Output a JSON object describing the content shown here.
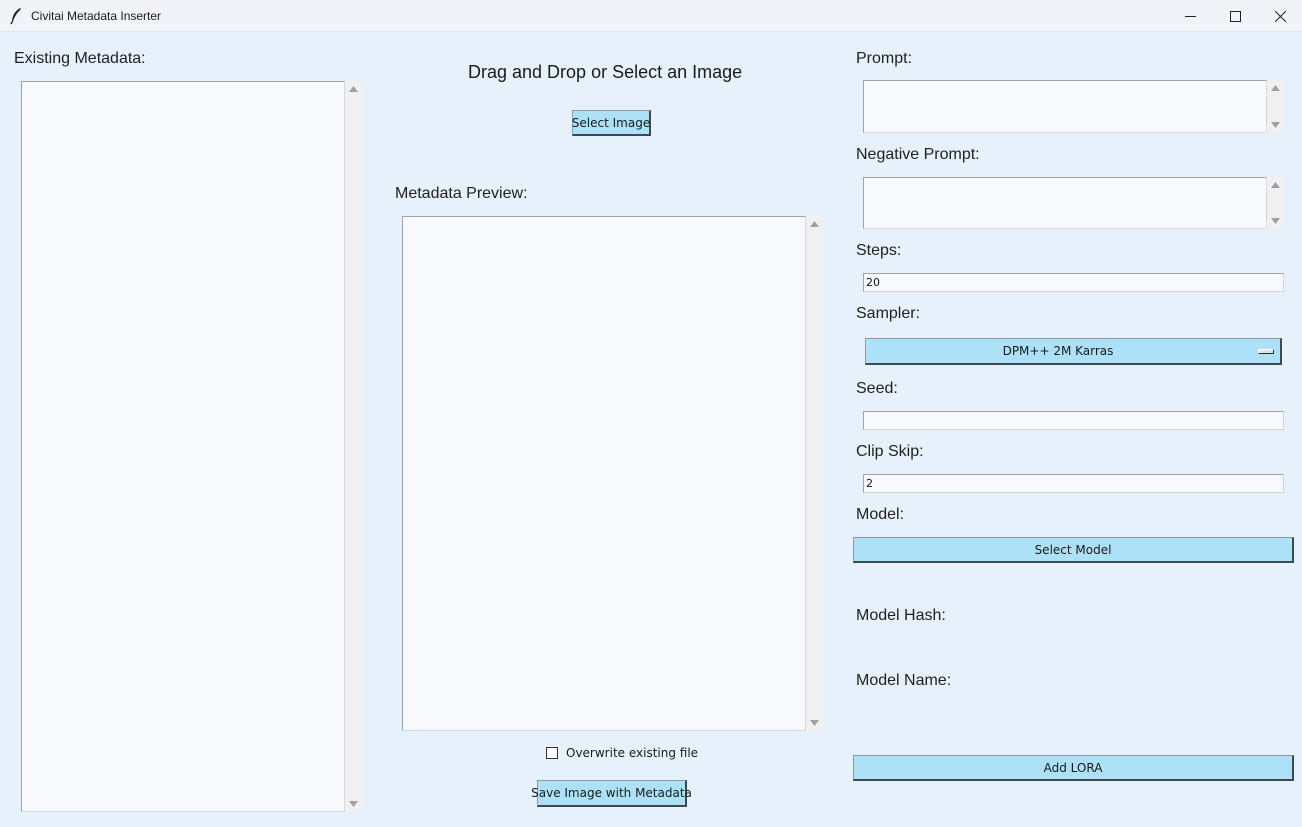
{
  "window": {
    "title": "Civitai Metadata Inserter",
    "icon": "feather-icon",
    "controls": [
      "minimize-icon",
      "maximize-icon",
      "close-icon"
    ]
  },
  "left": {
    "existing_label": "Existing Metadata:"
  },
  "center": {
    "heading": "Drag and Drop or Select an Image",
    "select_image_label": "Select Image",
    "preview_label": "Metadata Preview:",
    "overwrite_label": "Overwrite existing file",
    "overwrite_checked": false,
    "save_label": "Save Image with Metadata"
  },
  "right": {
    "prompt_label": "Prompt:",
    "negative_label": "Negative Prompt:",
    "steps_label": "Steps:",
    "steps_value": "20",
    "sampler_label": "Sampler:",
    "sampler_value": "DPM++ 2M Karras",
    "seed_label": "Seed:",
    "seed_value": "",
    "clip_label": "Clip Skip:",
    "clip_value": "2",
    "model_label": "Model:",
    "select_model_label": "Select Model",
    "model_hash_label": "Model Hash:",
    "model_name_label": "Model Name:",
    "add_lora_label": "Add LORA"
  },
  "colors": {
    "window_bg": "#e6f1fb",
    "button_bg": "#ade1f7",
    "field_bg": "#f7f9fd"
  }
}
